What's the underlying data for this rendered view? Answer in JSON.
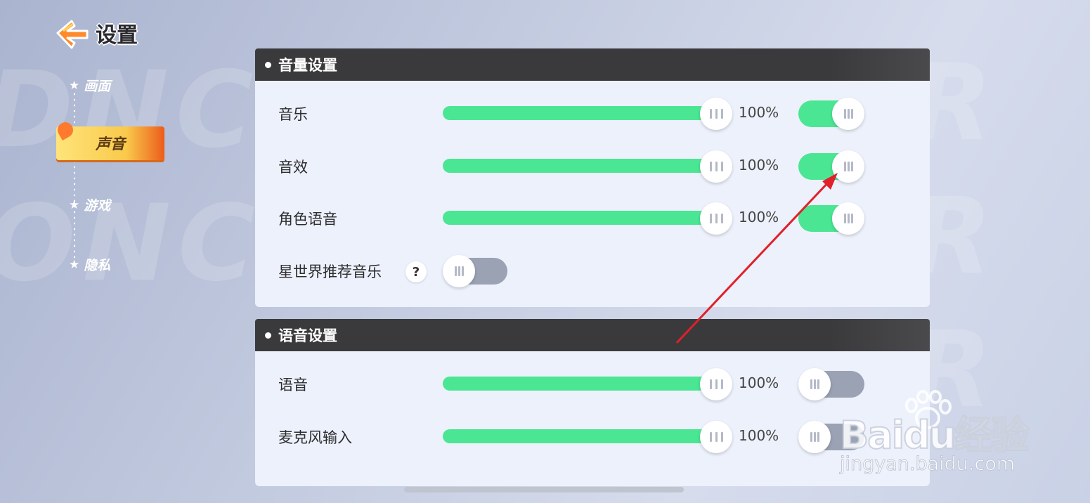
{
  "header": {
    "title": "设置",
    "back_icon": "back-arrow-icon"
  },
  "sidenav": {
    "items": [
      {
        "label": "画面",
        "active": false
      },
      {
        "label": "声音",
        "active": true
      },
      {
        "label": "游戏",
        "active": false
      },
      {
        "label": "隐私",
        "active": false
      }
    ]
  },
  "volume_panel": {
    "title": "音量设置",
    "rows": [
      {
        "label": "音乐",
        "slider_value": 100,
        "value_text": "100%",
        "toggle_on": true
      },
      {
        "label": "音效",
        "slider_value": 100,
        "value_text": "100%",
        "toggle_on": true
      },
      {
        "label": "角色语音",
        "slider_value": 100,
        "value_text": "100%",
        "toggle_on": true
      }
    ],
    "recommend": {
      "label": "星世界推荐音乐",
      "help": "?",
      "toggle_on": false
    }
  },
  "voice_panel": {
    "title": "语音设置",
    "rows": [
      {
        "label": "语音",
        "slider_value": 100,
        "value_text": "100%",
        "toggle_on": false
      },
      {
        "label": "麦克风输入",
        "slider_value": 100,
        "value_text": "100%",
        "toggle_on": false
      }
    ]
  },
  "watermark": {
    "logo": "Baidu经验",
    "url": "jingyan.baidu.com"
  },
  "colors": {
    "accent_green": "#4be693",
    "toggle_off": "#9aa2b4",
    "header_dark": "#3a3a3c",
    "annotation_red": "#e0202a"
  }
}
